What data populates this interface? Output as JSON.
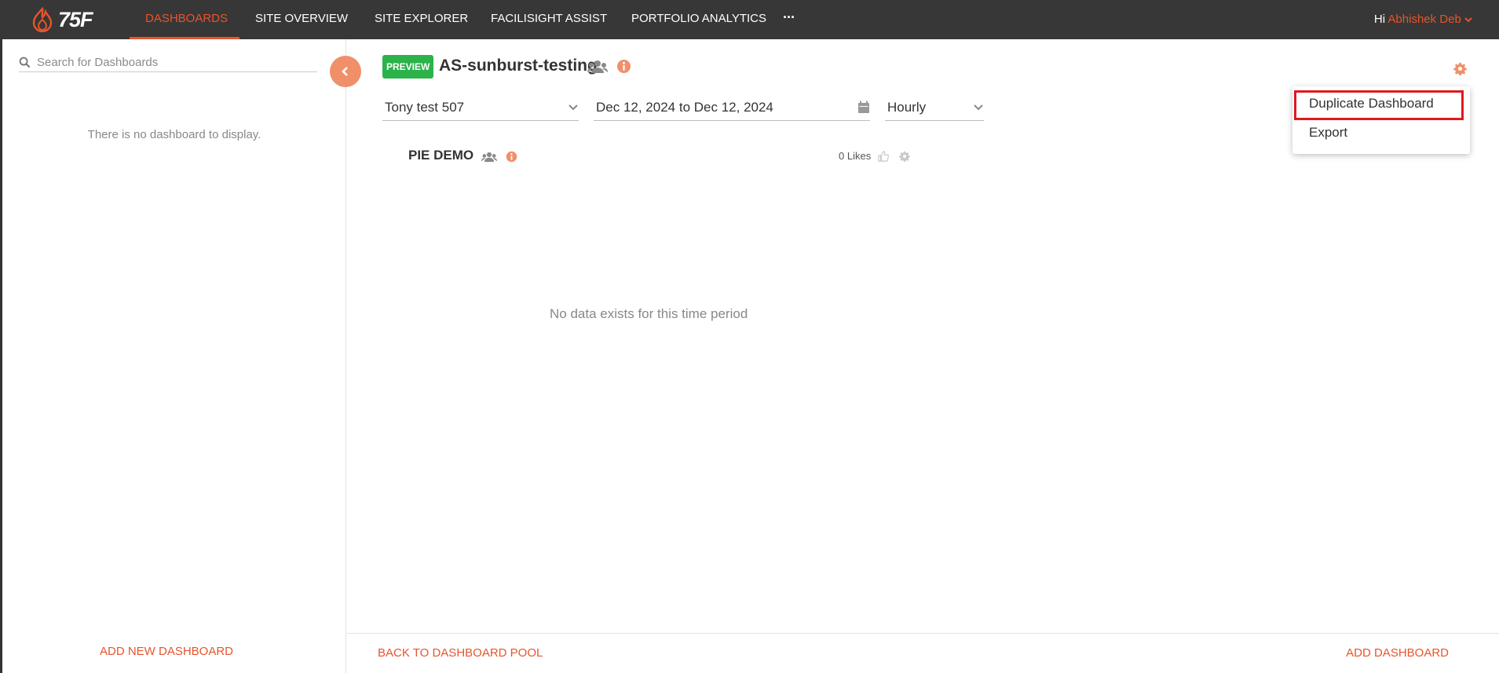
{
  "nav": {
    "logo_text": "75F",
    "items": [
      {
        "label": "DASHBOARDS",
        "active": true
      },
      {
        "label": "SITE OVERVIEW",
        "active": false
      },
      {
        "label": "SITE EXPLORER",
        "active": false
      },
      {
        "label": "FACILISIGHT ASSIST",
        "active": false
      },
      {
        "label": "PORTFOLIO ANALYTICS",
        "active": false
      }
    ],
    "more_label": "···",
    "greeting_prefix": "Hi",
    "user_name": "Abhishek Deb"
  },
  "sidebar": {
    "search_placeholder": "Search for Dashboards",
    "empty_message": "There is no dashboard to display.",
    "add_new_label": "ADD NEW DASHBOARD"
  },
  "dashboard": {
    "badge": "PREVIEW",
    "title": "AS-sunburst-testing",
    "site": "Tony test 507",
    "date_range": "Dec 12, 2024 to Dec 12, 2024",
    "interval": "Hourly"
  },
  "widget": {
    "title": "PIE DEMO",
    "likes": "0 Likes",
    "empty_message": "No data exists for this time period"
  },
  "footer": {
    "back_label": "BACK TO DASHBOARD POOL",
    "add_label": "ADD DASHBOARD"
  },
  "settings_menu": {
    "items": [
      "Duplicate Dashboard",
      "Export"
    ]
  },
  "colors": {
    "accent": "#e8542b",
    "topbar": "#373737",
    "badge": "#2bb34a",
    "highlight": "#e0191f"
  }
}
